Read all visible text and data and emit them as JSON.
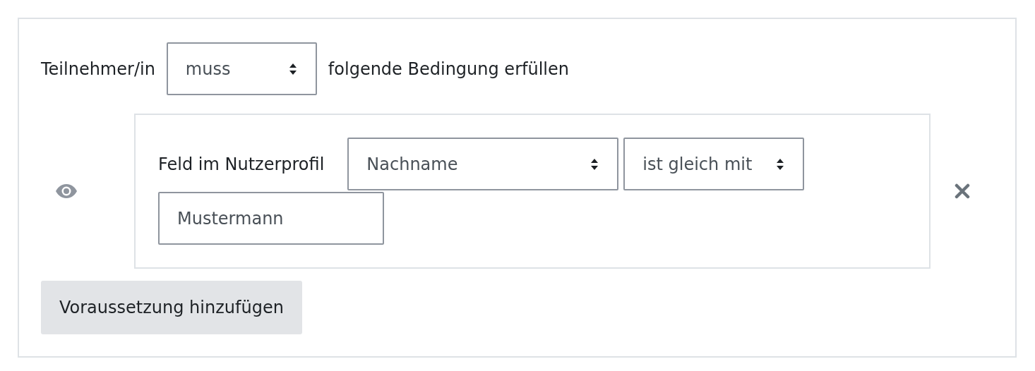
{
  "condition_header": {
    "prefix": "Teilnehmer/in",
    "select": "muss",
    "suffix": "folgende Bedingung erfüllen"
  },
  "conditions": [
    {
      "label": "Feld im Nutzerprofil",
      "field_select": "Nachname",
      "operator_select": "ist gleich mit",
      "value": "Mustermann"
    }
  ],
  "add_button": "Voraussetzung hinzufügen"
}
